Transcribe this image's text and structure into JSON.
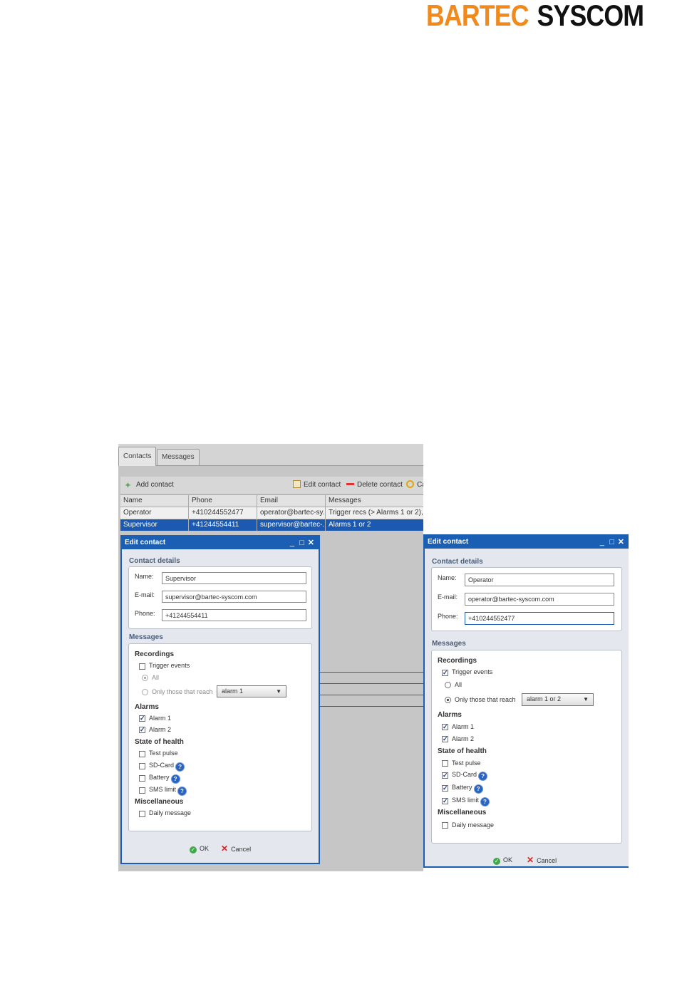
{
  "brand": {
    "part1": "BARTEC",
    "part2": "SYSCOM"
  },
  "app": {
    "tabs": [
      "Contacts",
      "Messages"
    ],
    "toolbar": {
      "add": "Add contact",
      "edit": "Edit contact",
      "delete": "Delete contact",
      "cancel": "Ca"
    },
    "grid": {
      "headers": [
        "Name",
        "Phone",
        "Email",
        "Messages"
      ],
      "rows": [
        [
          "Operator",
          "+410244552477",
          "operator@bartec-sy...",
          "Trigger recs (> Alarms 1 or 2), Al"
        ],
        [
          "Supervisor",
          "+41244554411",
          "supervisor@bartec-...",
          "Alarms 1 or 2"
        ]
      ]
    }
  },
  "dialog_left": {
    "title": "Edit contact",
    "contact_details": "Contact details",
    "name_label": "Name:",
    "name_value": "Supervisor",
    "email_label": "E-mail:",
    "email_value": "supervisor@bartec-syscom.com",
    "phone_label": "Phone:",
    "phone_value": "+41244554411",
    "messages": "Messages",
    "recordings": "Recordings",
    "trigger_events": "Trigger events",
    "all": "All",
    "only_those": "Only those that reach",
    "alarm_select": "alarm 1",
    "alarms": "Alarms",
    "alarm1": "Alarm 1",
    "alarm2": "Alarm 2",
    "soh": "State of health",
    "test_pulse": "Test pulse",
    "sd_card": "SD-Card",
    "battery": "Battery",
    "sms_limit": "SMS limit",
    "misc": "Miscellaneous",
    "daily": "Daily message",
    "ok": "OK",
    "cancel": "Cancel"
  },
  "dialog_right": {
    "title": "Edit contact",
    "contact_details": "Contact details",
    "name_label": "Name:",
    "name_value": "Operator",
    "email_label": "E-mail:",
    "email_value": "operator@bartec-syscom.com",
    "phone_label": "Phone:",
    "phone_value": "+410244552477",
    "messages": "Messages",
    "recordings": "Recordings",
    "trigger_events": "Trigger events",
    "all": "All",
    "only_those": "Only those that reach",
    "alarm_select": "alarm 1 or 2",
    "alarms": "Alarms",
    "alarm1": "Alarm 1",
    "alarm2": "Alarm 2",
    "soh": "State of health",
    "test_pulse": "Test pulse",
    "sd_card": "SD-Card",
    "battery": "Battery",
    "sms_limit": "SMS limit",
    "misc": "Miscellaneous",
    "daily": "Daily message",
    "ok": "OK",
    "cancel": "Cancel"
  },
  "icons": {
    "add": "plus-icon",
    "edit": "edit-icon",
    "delete": "minus-icon",
    "help": "help-icon",
    "ok": "check-icon",
    "cancel": "x-icon"
  },
  "colors": {
    "brand_orange": "#f08a1c",
    "dialog_blue": "#1a5fb4",
    "selection": "#1b5ab0"
  }
}
